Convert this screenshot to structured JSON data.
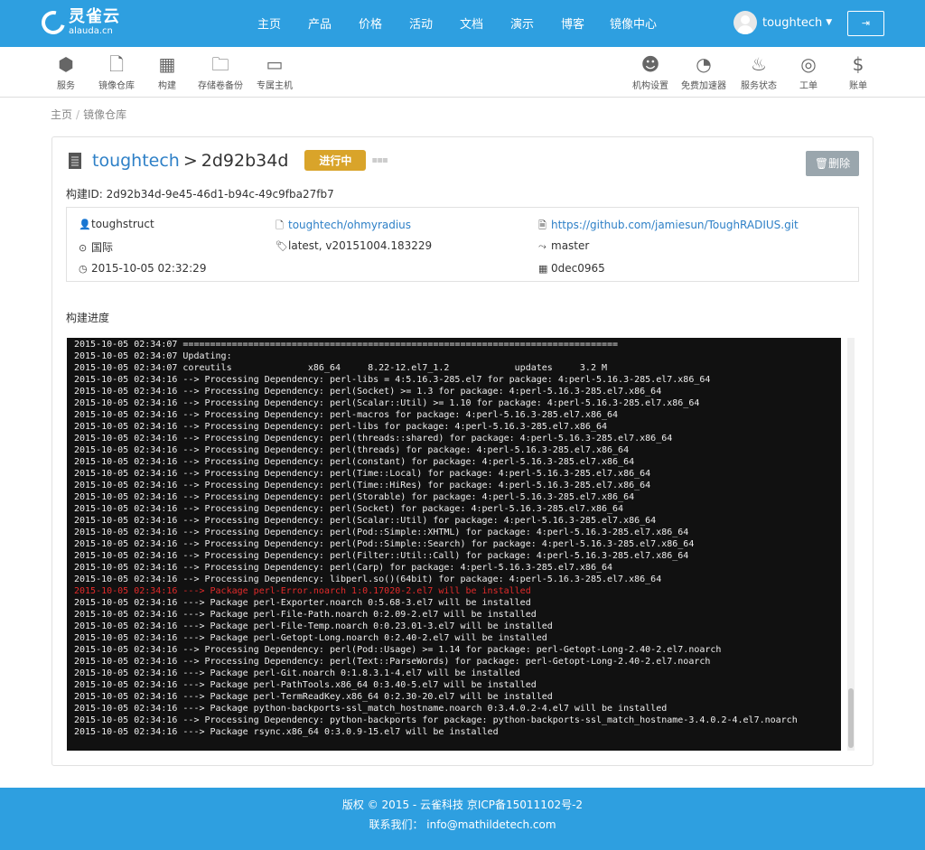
{
  "brand": {
    "name_cn": "灵雀云",
    "name_en": "alauda.cn"
  },
  "nav": {
    "items": [
      "主页",
      "产品",
      "价格",
      "活动",
      "文档",
      "演示",
      "博客",
      "镜像中心"
    ]
  },
  "user": {
    "name": "toughtech"
  },
  "toolbar_left": [
    {
      "label": "服务",
      "icon": "cubes-icon"
    },
    {
      "label": "镜像仓库",
      "icon": "file-icon"
    },
    {
      "label": "构建",
      "icon": "building-icon"
    },
    {
      "label": "存储卷备份",
      "icon": "folder-icon"
    },
    {
      "label": "专属主机",
      "icon": "monitor-icon"
    }
  ],
  "toolbar_right": [
    {
      "label": "机构设置",
      "icon": "users-icon"
    },
    {
      "label": "免费加速器",
      "icon": "dashboard-icon"
    },
    {
      "label": "服务状态",
      "icon": "fire-icon"
    },
    {
      "label": "工单",
      "icon": "lifebuoy-icon"
    },
    {
      "label": "账单",
      "icon": "dollar-icon"
    }
  ],
  "breadcrumb": {
    "home": "主页",
    "current": "镜像仓库"
  },
  "build": {
    "repo_owner": "toughtech",
    "separator": ">",
    "build_short_id": "2d92b34d",
    "status": "进行中",
    "delete_label": "删除",
    "build_id_label": "构建ID: 2d92b34d-9e45-46d1-b94c-49c9fba27fb7",
    "user": "toughstruct",
    "repo_link": "toughtech/ohmyradius",
    "git_url": "https://github.com/jamiesun/ToughRADIUS.git",
    "region": "国际",
    "tags": "latest, v20151004.183229",
    "branch": "master",
    "time": "2015-10-05 02:32:29",
    "commit": "0dec0965"
  },
  "progress_title": "构建进度",
  "log": [
    {
      "t": "2015-10-05 02:34:07 ================================================================================",
      "red": false
    },
    {
      "t": "2015-10-05 02:34:07 Updating:",
      "red": false
    },
    {
      "t": "2015-10-05 02:34:07 coreutils              x86_64     8.22-12.el7_1.2            updates     3.2 M",
      "red": false
    },
    {
      "t": "2015-10-05 02:34:16 --> Processing Dependency: perl-libs = 4:5.16.3-285.el7 for package: 4:perl-5.16.3-285.el7.x86_64",
      "red": false
    },
    {
      "t": "2015-10-05 02:34:16 --> Processing Dependency: perl(Socket) >= 1.3 for package: 4:perl-5.16.3-285.el7.x86_64",
      "red": false
    },
    {
      "t": "2015-10-05 02:34:16 --> Processing Dependency: perl(Scalar::Util) >= 1.10 for package: 4:perl-5.16.3-285.el7.x86_64",
      "red": false
    },
    {
      "t": "2015-10-05 02:34:16 --> Processing Dependency: perl-macros for package: 4:perl-5.16.3-285.el7.x86_64",
      "red": false
    },
    {
      "t": "2015-10-05 02:34:16 --> Processing Dependency: perl-libs for package: 4:perl-5.16.3-285.el7.x86_64",
      "red": false
    },
    {
      "t": "2015-10-05 02:34:16 --> Processing Dependency: perl(threads::shared) for package: 4:perl-5.16.3-285.el7.x86_64",
      "red": false
    },
    {
      "t": "2015-10-05 02:34:16 --> Processing Dependency: perl(threads) for package: 4:perl-5.16.3-285.el7.x86_64",
      "red": false
    },
    {
      "t": "2015-10-05 02:34:16 --> Processing Dependency: perl(constant) for package: 4:perl-5.16.3-285.el7.x86_64",
      "red": false
    },
    {
      "t": "2015-10-05 02:34:16 --> Processing Dependency: perl(Time::Local) for package: 4:perl-5.16.3-285.el7.x86_64",
      "red": false
    },
    {
      "t": "2015-10-05 02:34:16 --> Processing Dependency: perl(Time::HiRes) for package: 4:perl-5.16.3-285.el7.x86_64",
      "red": false
    },
    {
      "t": "2015-10-05 02:34:16 --> Processing Dependency: perl(Storable) for package: 4:perl-5.16.3-285.el7.x86_64",
      "red": false
    },
    {
      "t": "2015-10-05 02:34:16 --> Processing Dependency: perl(Socket) for package: 4:perl-5.16.3-285.el7.x86_64",
      "red": false
    },
    {
      "t": "2015-10-05 02:34:16 --> Processing Dependency: perl(Scalar::Util) for package: 4:perl-5.16.3-285.el7.x86_64",
      "red": false
    },
    {
      "t": "2015-10-05 02:34:16 --> Processing Dependency: perl(Pod::Simple::XHTML) for package: 4:perl-5.16.3-285.el7.x86_64",
      "red": false
    },
    {
      "t": "2015-10-05 02:34:16 --> Processing Dependency: perl(Pod::Simple::Search) for package: 4:perl-5.16.3-285.el7.x86_64",
      "red": false
    },
    {
      "t": "2015-10-05 02:34:16 --> Processing Dependency: perl(Filter::Util::Call) for package: 4:perl-5.16.3-285.el7.x86_64",
      "red": false
    },
    {
      "t": "2015-10-05 02:34:16 --> Processing Dependency: perl(Carp) for package: 4:perl-5.16.3-285.el7.x86_64",
      "red": false
    },
    {
      "t": "2015-10-05 02:34:16 --> Processing Dependency: libperl.so()(64bit) for package: 4:perl-5.16.3-285.el7.x86_64",
      "red": false
    },
    {
      "t": "2015-10-05 02:34:16 ---> Package perl-Error.noarch 1:0.17020-2.el7 will be installed",
      "red": true
    },
    {
      "t": "2015-10-05 02:34:16 ---> Package perl-Exporter.noarch 0:5.68-3.el7 will be installed",
      "red": false
    },
    {
      "t": "2015-10-05 02:34:16 ---> Package perl-File-Path.noarch 0:2.09-2.el7 will be installed",
      "red": false
    },
    {
      "t": "2015-10-05 02:34:16 ---> Package perl-File-Temp.noarch 0:0.23.01-3.el7 will be installed",
      "red": false
    },
    {
      "t": "2015-10-05 02:34:16 ---> Package perl-Getopt-Long.noarch 0:2.40-2.el7 will be installed",
      "red": false
    },
    {
      "t": "2015-10-05 02:34:16 --> Processing Dependency: perl(Pod::Usage) >= 1.14 for package: perl-Getopt-Long-2.40-2.el7.noarch",
      "red": false
    },
    {
      "t": "2015-10-05 02:34:16 --> Processing Dependency: perl(Text::ParseWords) for package: perl-Getopt-Long-2.40-2.el7.noarch",
      "red": false
    },
    {
      "t": "2015-10-05 02:34:16 ---> Package perl-Git.noarch 0:1.8.3.1-4.el7 will be installed",
      "red": false
    },
    {
      "t": "2015-10-05 02:34:16 ---> Package perl-PathTools.x86_64 0:3.40-5.el7 will be installed",
      "red": false
    },
    {
      "t": "2015-10-05 02:34:16 ---> Package perl-TermReadKey.x86_64 0:2.30-20.el7 will be installed",
      "red": false
    },
    {
      "t": "2015-10-05 02:34:16 ---> Package python-backports-ssl_match_hostname.noarch 0:3.4.0.2-4.el7 will be installed",
      "red": false
    },
    {
      "t": "2015-10-05 02:34:16 --> Processing Dependency: python-backports for package: python-backports-ssl_match_hostname-3.4.0.2-4.el7.noarch",
      "red": false
    },
    {
      "t": "2015-10-05 02:34:16 ---> Package rsync.x86_64 0:3.0.9-15.el7 will be installed",
      "red": false
    }
  ],
  "footer": {
    "line1": "版权 © 2015 - 云雀科技    京ICP备15011102号-2",
    "line2": "联系我们： info@mathildetech.com"
  },
  "colors": {
    "primary": "#2e9fe0",
    "status": "#d9a42a",
    "link": "#2e80c7",
    "log_error": "#e32b2b"
  }
}
